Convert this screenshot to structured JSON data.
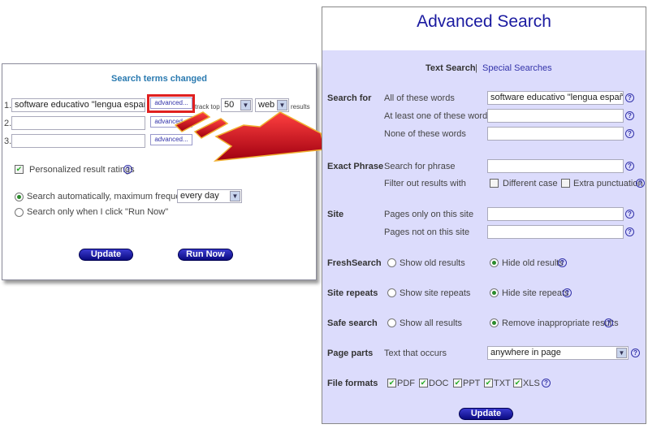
{
  "left_panel": {
    "title": "Search terms changed",
    "rows": [
      {
        "num": "1.",
        "query": "software educativo \"lengua española\"",
        "advanced": "advanced...",
        "track_top": "track top",
        "count": "50",
        "type": "web",
        "results": "results"
      },
      {
        "num": "2.",
        "query": "",
        "advanced": "advanced..."
      },
      {
        "num": "3.",
        "query": "",
        "advanced": "advanced..."
      }
    ],
    "personalized": {
      "label": "Personalized result ratings",
      "checked": true
    },
    "auto_search": {
      "label": "Search automatically, maximum frequency",
      "selected": true,
      "frequency": "every day"
    },
    "manual_search": {
      "label": "Search only when I click \"Run Now\"",
      "selected": false
    },
    "update_button": "Update",
    "run_now_button": "Run Now"
  },
  "right_panel": {
    "title": "Advanced Search",
    "tab_active": "Text Search",
    "separator": "|",
    "tab_link": "Special Searches",
    "search_for": {
      "label": "Search for",
      "all_label": "All of these words",
      "all_value": "software educativo \"lengua española\"",
      "any_label": "At least one of these words",
      "any_value": "",
      "none_label": "None of these words",
      "none_value": ""
    },
    "exact": {
      "label": "Exact Phrase",
      "phrase_label": "Search for phrase",
      "phrase_value": "",
      "filter_label": "Filter out results with",
      "case_label": "Different case",
      "case_checked": false,
      "punct_label": "Extra punctuation",
      "punct_checked": false
    },
    "site": {
      "label": "Site",
      "only_label": "Pages only on this site",
      "only_value": "",
      "not_label": "Pages not on this site",
      "not_value": ""
    },
    "fresh": {
      "label": "FreshSearch",
      "opt1": "Show old results",
      "opt2": "Hide old results",
      "selected": "Hide old results"
    },
    "repeats": {
      "label": "Site repeats",
      "opt1": "Show site repeats",
      "opt2": "Hide site repeats",
      "selected": "Hide site repeats"
    },
    "safe": {
      "label": "Safe search",
      "opt1": "Show all results",
      "opt2": "Remove inappropriate results",
      "selected": "Remove inappropriate results"
    },
    "parts": {
      "label": "Page parts",
      "sub": "Text that occurs",
      "value": "anywhere in page"
    },
    "formats": {
      "label": "File formats",
      "items": [
        "PDF",
        "DOC",
        "PPT",
        "TXT",
        "XLS"
      ]
    },
    "update_button": "Update"
  },
  "help_glyph": "?",
  "check_glyph": "✔",
  "arrow_glyph": "▼",
  "colors": {
    "accent": "#1a1aa0",
    "panel_bg": "#dcdcfc",
    "highlight": "#e02020",
    "arrow": "#d00010"
  }
}
